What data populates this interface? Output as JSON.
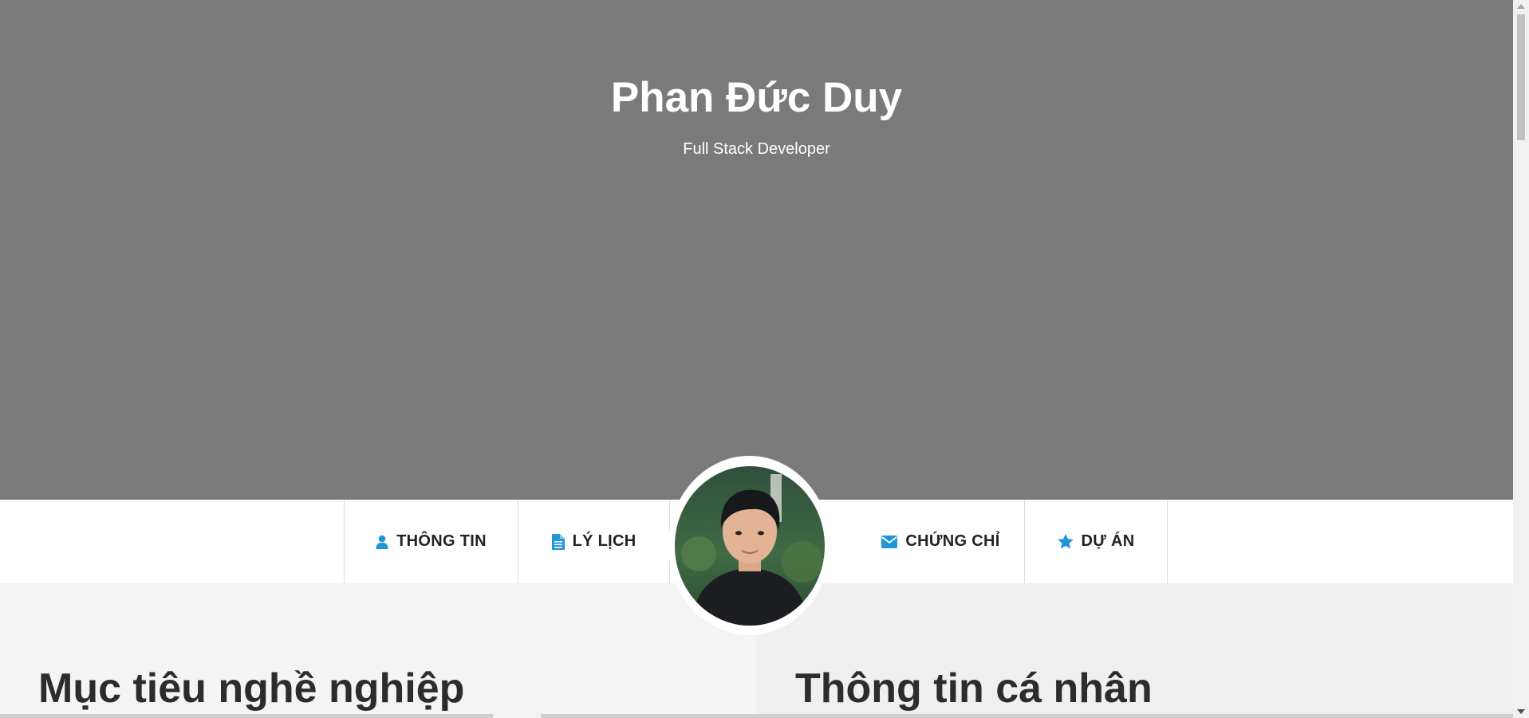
{
  "hero": {
    "name": "Phan Đức Duy",
    "subtitle": "Full Stack Developer"
  },
  "nav": {
    "items": [
      {
        "label": "THÔNG TIN",
        "icon": "user-icon"
      },
      {
        "label": "LÝ LỊCH",
        "icon": "document-icon"
      },
      {
        "label": "CHỨNG CHỈ",
        "icon": "envelope-icon"
      },
      {
        "label": "DỰ ÁN",
        "icon": "star-icon"
      }
    ],
    "icon_color": "#2196d6"
  },
  "sections": {
    "left_title": "Mục tiêu nghề nghiệp",
    "right_title": "Thông tin cá nhân"
  },
  "colors": {
    "hero_bg": "#7a7a7a",
    "nav_bg": "#ffffff",
    "accent": "#2196d6"
  }
}
